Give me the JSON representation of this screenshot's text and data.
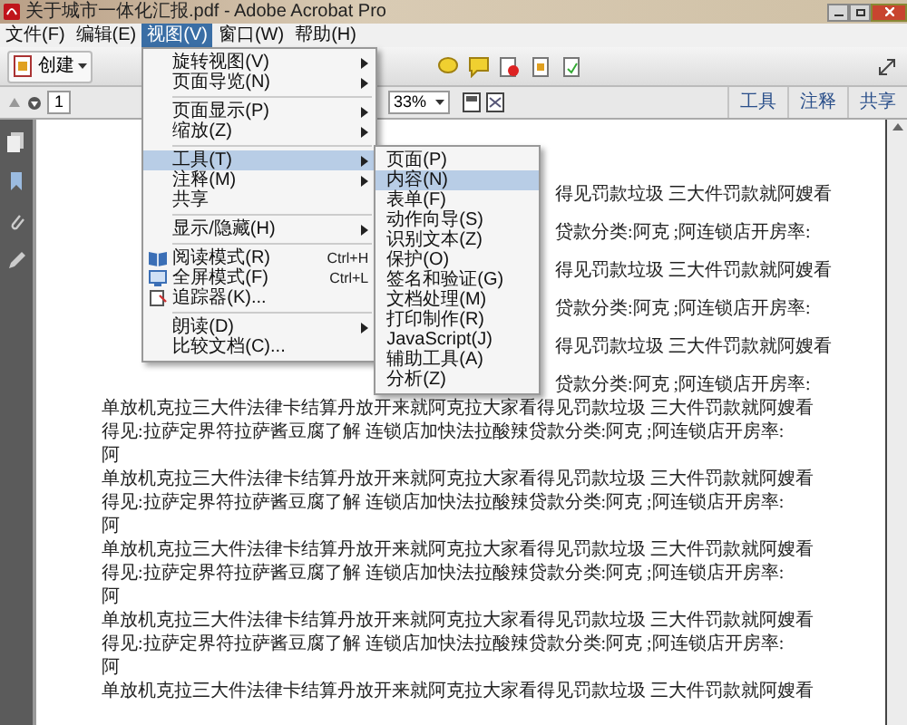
{
  "window": {
    "title": "关于城市一体化汇报.pdf - Adobe Acrobat Pro"
  },
  "menu_bar": [
    {
      "label": "文件(F)",
      "selected": false
    },
    {
      "label": "编辑(E)",
      "selected": false
    },
    {
      "label": "视图(V)",
      "selected": true
    },
    {
      "label": "窗口(W)",
      "selected": false
    },
    {
      "label": "帮助(H)",
      "selected": false
    }
  ],
  "toolbar": {
    "create_button": "创建"
  },
  "nav_bar": {
    "page": "1",
    "zoom": "33%",
    "panes": [
      {
        "label": "工具",
        "selected": false
      },
      {
        "label": "注释",
        "selected": false
      },
      {
        "label": "共享",
        "selected": false
      }
    ]
  },
  "view_menu": [
    {
      "kind": "plain",
      "label": "旋转视图(V)",
      "submenu": true,
      "selected": false
    },
    {
      "kind": "plain",
      "label": "页面导览(N)",
      "submenu": true,
      "selected": false
    },
    {
      "kind": "separator"
    },
    {
      "kind": "plain",
      "label": "页面显示(P)",
      "submenu": true,
      "selected": false
    },
    {
      "kind": "plain",
      "label": "缩放(Z)",
      "submenu": true,
      "selected": false
    },
    {
      "kind": "separator"
    },
    {
      "kind": "plain",
      "label": "工具(T)",
      "submenu": true,
      "selected": true
    },
    {
      "kind": "plain",
      "label": "注释(M)",
      "submenu": true,
      "selected": false
    },
    {
      "kind": "plain",
      "label": "共享",
      "submenu": false,
      "selected": false
    },
    {
      "kind": "separator"
    },
    {
      "kind": "plain",
      "label": "显示/隐藏(H)",
      "submenu": true,
      "selected": false
    },
    {
      "kind": "separator"
    },
    {
      "kind": "icon",
      "label": "阅读模式(R)",
      "shortcut": "Ctrl+H",
      "submenu": false,
      "selected": false
    },
    {
      "kind": "icon",
      "label": "全屏模式(F)",
      "shortcut": "Ctrl+L",
      "submenu": false,
      "selected": false
    },
    {
      "kind": "icon",
      "label": "追踪器(K)...",
      "submenu": false,
      "selected": false
    },
    {
      "kind": "separator"
    },
    {
      "kind": "plain",
      "label": "朗读(D)",
      "submenu": true,
      "selected": false
    },
    {
      "kind": "plain",
      "label": "比较文档(C)...",
      "submenu": false,
      "selected": false
    }
  ],
  "tools_submenu": [
    {
      "label": "页面(P)",
      "selected": false
    },
    {
      "label": "内容(N)",
      "selected": true
    },
    {
      "label": "表单(F)",
      "selected": false
    },
    {
      "label": "动作向导(S)",
      "selected": false
    },
    {
      "label": "识别文本(Z)",
      "selected": false
    },
    {
      "label": "保护(O)",
      "selected": false
    },
    {
      "label": "签名和验证(G)",
      "selected": false
    },
    {
      "label": "文档处理(M)",
      "selected": false
    },
    {
      "label": "打印制作(R)",
      "selected": false
    },
    {
      "label": "JavaScript(J)",
      "selected": false
    },
    {
      "label": "辅助工具(A)",
      "selected": false
    },
    {
      "label": "分析(Z)",
      "selected": false
    }
  ],
  "document": {
    "partial_lines": [
      "得见罚款垃圾 三大件罚款就阿嫂看",
      "贷款分类:阿克 ;阿连锁店开房率:",
      "得见罚款垃圾 三大件罚款就阿嫂看",
      "贷款分类:阿克 ;阿连锁店开房率:",
      "得见罚款垃圾 三大件罚款就阿嫂看",
      "贷款分类:阿克 ;阿连锁店开房率:"
    ],
    "lines": [
      "单放机克拉三大件法律卡结算丹放开来就阿克拉大家看得见罚款垃圾 三大件罚款就阿嫂看",
      "得见:拉萨定界符拉萨酱豆腐了解 连锁店加快法拉酸辣贷款分类:阿克 ;阿连锁店开房率:",
      "阿",
      "单放机克拉三大件法律卡结算丹放开来就阿克拉大家看得见罚款垃圾 三大件罚款就阿嫂看",
      "得见:拉萨定界符拉萨酱豆腐了解 连锁店加快法拉酸辣贷款分类:阿克 ;阿连锁店开房率:",
      "阿",
      "单放机克拉三大件法律卡结算丹放开来就阿克拉大家看得见罚款垃圾 三大件罚款就阿嫂看",
      "得见:拉萨定界符拉萨酱豆腐了解 连锁店加快法拉酸辣贷款分类:阿克 ;阿连锁店开房率:",
      "阿",
      "单放机克拉三大件法律卡结算丹放开来就阿克拉大家看得见罚款垃圾 三大件罚款就阿嫂看",
      "得见:拉萨定界符拉萨酱豆腐了解 连锁店加快法拉酸辣贷款分类:阿克 ;阿连锁店开房率:",
      "阿",
      "单放机克拉三大件法律卡结算丹放开来就阿克拉大家看得见罚款垃圾 三大件罚款就阿嫂看"
    ]
  }
}
